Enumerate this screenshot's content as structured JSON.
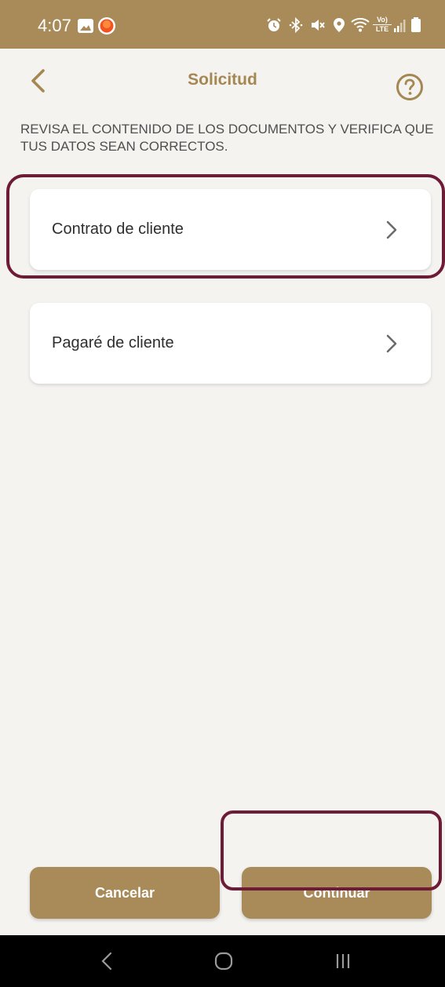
{
  "status_bar": {
    "time": "4:07",
    "left_icons": [
      "gallery-icon",
      "app-notification-icon"
    ],
    "right_icons": [
      "alarm-icon",
      "bluetooth-icon",
      "mute-icon",
      "location-icon",
      "wifi-icon",
      "volte-icon",
      "signal-icon",
      "battery-icon"
    ],
    "volte_label_top": "Vo)",
    "volte_label_bottom": "LTE"
  },
  "header": {
    "title": "Solicitud",
    "back_icon": "chevron-left-icon",
    "help_icon": "question-circle-icon"
  },
  "instructions": "REVISA EL CONTENIDO DE LOS DOCUMENTOS Y VERIFICA QUE TUS DATOS SEAN CORRECTOS.",
  "documents": [
    {
      "label": "Contrato de cliente"
    },
    {
      "label": "Pagaré de cliente"
    }
  ],
  "actions": {
    "cancel_label": "Cancelar",
    "continue_label": "Continuar"
  },
  "colors": {
    "brand_gold": "#a98a59",
    "title_gold": "#a58752",
    "highlight_maroon": "#6e1b37",
    "background": "#f4f3f0"
  }
}
